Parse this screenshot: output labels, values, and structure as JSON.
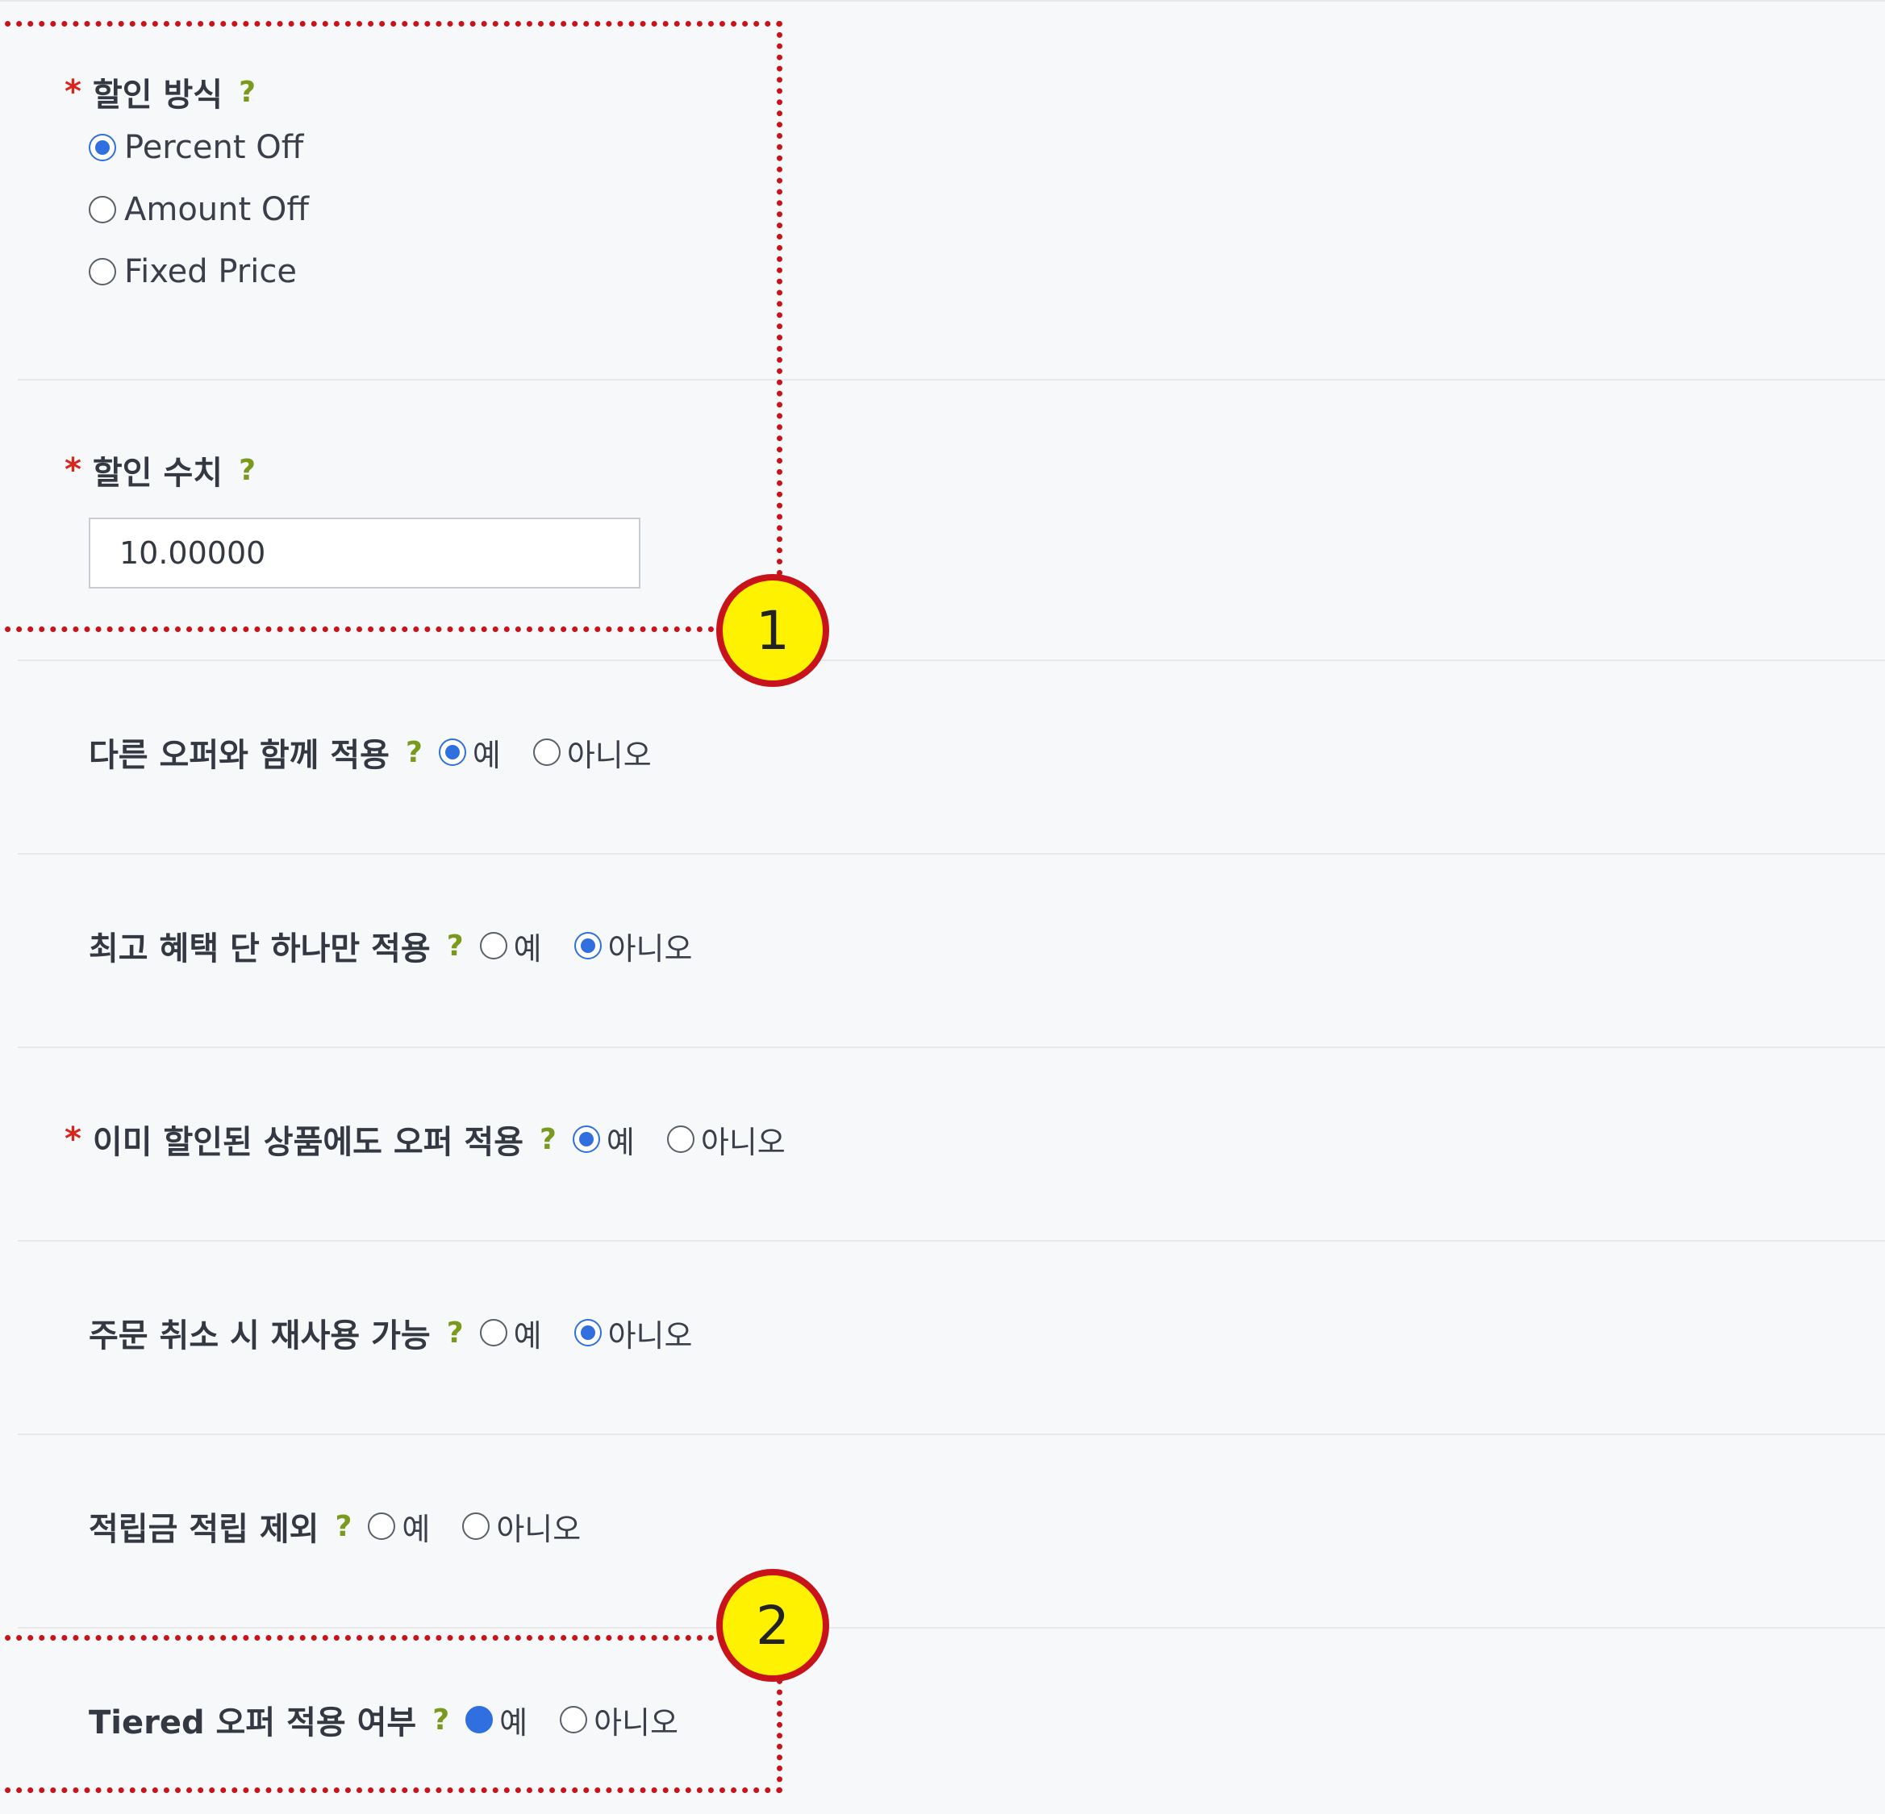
{
  "discount_method": {
    "required_mark": "*",
    "label": "할인 방식",
    "help": "?",
    "options": [
      {
        "label": "Percent Off",
        "checked": true
      },
      {
        "label": "Amount Off",
        "checked": false
      },
      {
        "label": "Fixed Price",
        "checked": false
      }
    ]
  },
  "discount_value": {
    "required_mark": "*",
    "label": "할인 수치",
    "help": "?",
    "value": "10.00000"
  },
  "settings": [
    {
      "label": "다른 오퍼와 함께 적용",
      "required": false,
      "help": "?",
      "yes": "예",
      "no": "아니오",
      "selected": "yes"
    },
    {
      "label": "최고 혜택 단 하나만 적용",
      "required": false,
      "help": "?",
      "yes": "예",
      "no": "아니오",
      "selected": "no"
    },
    {
      "label": "이미 할인된 상품에도 오퍼 적용",
      "required": true,
      "required_mark": "*",
      "help": "?",
      "yes": "예",
      "no": "아니오",
      "selected": "yes"
    },
    {
      "label": "주문 취소 시 재사용 가능",
      "required": false,
      "help": "?",
      "yes": "예",
      "no": "아니오",
      "selected": "no"
    },
    {
      "label": "적립금 적립 제외",
      "required": false,
      "help": "?",
      "yes": "예",
      "no": "아니오",
      "selected": "none"
    },
    {
      "label": "Tiered 오퍼 적용 여부",
      "required": false,
      "help": "?",
      "yes": "예",
      "no": "아니오",
      "selected": "yes"
    }
  ],
  "annotations": {
    "badge_1": "1",
    "badge_2": "2",
    "highlight_color": "#c8131a",
    "badge_color": "#fff200"
  },
  "colors": {
    "accent": "#2f6fe0",
    "required": "#d9261c",
    "help": "#7a9a1e"
  }
}
